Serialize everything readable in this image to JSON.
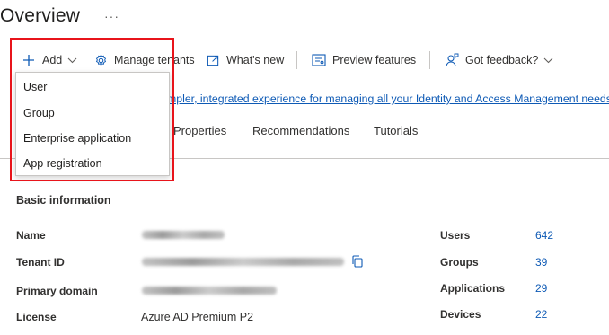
{
  "header": {
    "title": "Overview",
    "more": "···"
  },
  "toolbar": {
    "add": "Add",
    "manage_tenants": "Manage tenants",
    "whats_new": "What's new",
    "preview_features": "Preview features",
    "feedback": "Got feedback?"
  },
  "add_menu": {
    "items": [
      "User",
      "Group",
      "Enterprise application",
      "App registration"
    ]
  },
  "banner": {
    "text": "mpler, integrated experience for managing all your Identity and Access Management needs."
  },
  "tabs": [
    "Properties",
    "Recommendations",
    "Tutorials"
  ],
  "basic_info": {
    "title": "Basic information",
    "rows": [
      {
        "label": "Name",
        "value": ""
      },
      {
        "label": "Tenant ID",
        "value": ""
      },
      {
        "label": "Primary domain",
        "value": ""
      },
      {
        "label": "License",
        "value": "Azure AD Premium P2"
      }
    ]
  },
  "stats": [
    {
      "label": "Users",
      "value": "642"
    },
    {
      "label": "Groups",
      "value": "39"
    },
    {
      "label": "Applications",
      "value": "29"
    },
    {
      "label": "Devices",
      "value": "22"
    }
  ],
  "colors": {
    "accent": "#0e5ab5",
    "highlight": "#e8141b",
    "text": "#323130"
  }
}
